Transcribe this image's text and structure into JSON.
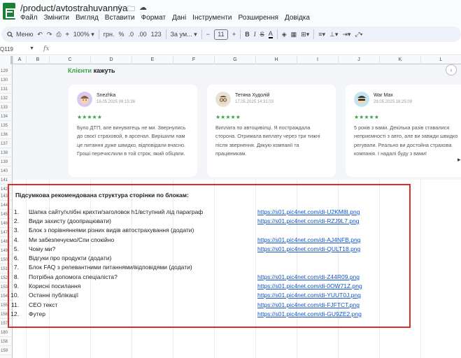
{
  "titlebar": {
    "doc_title": "/product/avtostrahuvannya",
    "star_icon": "☆",
    "folder_icon": "🗀",
    "cloud_icon": "☁"
  },
  "menu": [
    "Файл",
    "Змінити",
    "Вигляд",
    "Вставити",
    "Формат",
    "Дані",
    "Інструменти",
    "Розширення",
    "Довідка"
  ],
  "toolbar": {
    "search_label": "Меню",
    "zoom": "100%",
    "currency": "грн.",
    "percent": "%",
    "dec_decrease": ".0",
    "dec_increase": ".00",
    "number_format": "123",
    "font_name": "За ум...",
    "font_size": "11",
    "minus": "−",
    "plus": "+",
    "bold": "B",
    "italic": "I",
    "strike": "S",
    "text_color": "A"
  },
  "formula_bar": {
    "cell_ref": "Q119",
    "fx": "fx"
  },
  "columns": [
    "A",
    "B",
    "C",
    "D",
    "E",
    "F",
    "G",
    "H",
    "I",
    "J",
    "K",
    "L"
  ],
  "rows": [
    "129",
    "130",
    "131",
    "132",
    "133",
    "134",
    "135",
    "136",
    "137",
    "138",
    "139",
    "140",
    "141",
    "142",
    "143",
    "144",
    "145",
    "146",
    "147",
    "148",
    "149",
    "150",
    "151",
    "152",
    "153",
    "154",
    "155",
    "156",
    "157",
    "180",
    "158",
    "159",
    "180",
    "160"
  ],
  "reviews": {
    "title_green": "Клієнти",
    "title_dark": "кажуть",
    "carousel_prev": "‹",
    "stars": "★★★★★",
    "cards": [
      {
        "name": "Snezhka",
        "date": "16.05.2025 09:15:36",
        "text": "Було ДТП, але винуватець не ми. Звернулись до своєї страховой, в арсенал. Вирішили нам це питання дуже швидко, відповідали вчасно. Гроші перечислили в той строк, який обіцяли."
      },
      {
        "name": "Тетяна Худолій",
        "date": "17.05.2025 14:31:03",
        "text": "Виплата по автоцивілці. Я постраждала сторона. Отримала виплату через три тижні після звернення. Дякую компанії та працівникам."
      },
      {
        "name": "War Max",
        "date": "29.05.2025 16:25:09",
        "text": "5 років з вами. Декілька разів ставалися неприємності з авто, але ви завжди швидко регували. Реально ви достойна страхова компанія. І надалі буду з вами!"
      }
    ]
  },
  "block": {
    "heading": "Підсумкова рекомендована структура сторінки по блокам:",
    "items": [
      {
        "num": "1.",
        "label": "Шапка сайту/хлібні крихти/заголовок h1/вступний лід параграф",
        "link": "https://s01.pic4net.com/di-U2KM8I.png"
      },
      {
        "num": "2.",
        "label": "Види захисту (доопрацювати)",
        "link": "https://s01.pic4net.com/di-RZJ9L7.png"
      },
      {
        "num": "3.",
        "label": "Блок з порівняннями різних видів автострахування (додати)",
        "link": ""
      },
      {
        "num": "4.",
        "label": "Ми забезпечуємо/Спи спокійно",
        "link": "https://s01.pic4net.com/di-AJ4NFB.png"
      },
      {
        "num": "5.",
        "label": "Чому ми?",
        "link": "https://s01.pic4net.com/di-QULT18.png"
      },
      {
        "num": "6.",
        "label": "Відгуки про продукти (додати)",
        "link": ""
      },
      {
        "num": "7.",
        "label": "Блок FAQ з релевантними питаннями/відповідями (додати)",
        "link": ""
      },
      {
        "num": "8.",
        "label": "Потрібна допомога спеціаліста?",
        "link": "https://s01.pic4net.com/di-Z44R09.png"
      },
      {
        "num": "9.",
        "label": "Корисні посилання",
        "link": "https://s01.pic4net.com/di-0OW71Z.png"
      },
      {
        "num": "10.",
        "label": "Останні публікації",
        "link": "https://s01.pic4net.com/di-YUUT0J.png"
      },
      {
        "num": "11.",
        "label": "СЕО текст",
        "link": "https://s01.pic4net.com/di-FJFTCT.png"
      },
      {
        "num": "12.",
        "label": "Футер",
        "link": "https://s01.pic4net.com/di-GU9ZE2.png"
      }
    ]
  },
  "colors": {
    "accent_green": "#3aa34a",
    "frame_red": "#d93025",
    "link_blue": "#1155cc"
  }
}
